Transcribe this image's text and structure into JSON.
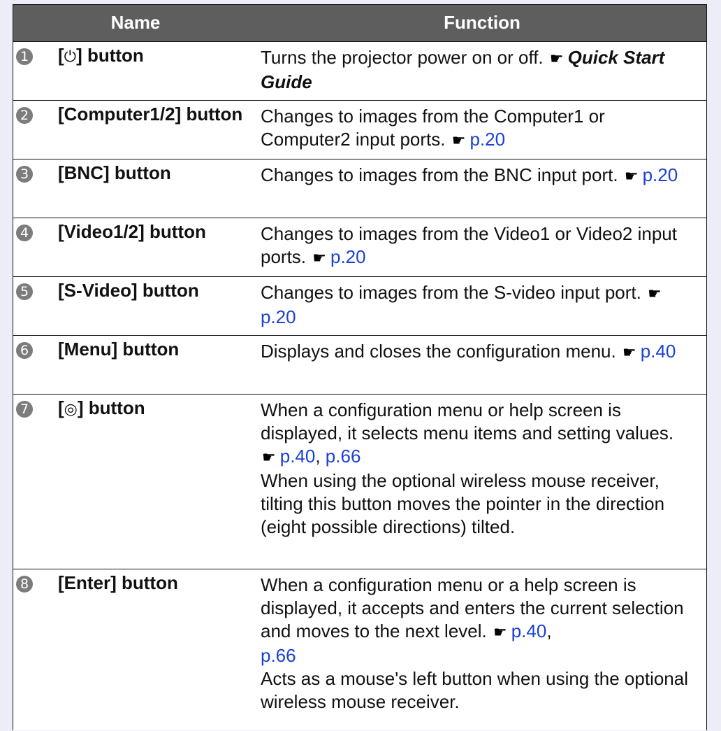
{
  "header": {
    "name": "Name",
    "function": "Function"
  },
  "rows": [
    {
      "number": "1",
      "name_pre": "[",
      "name_icon": "⏻",
      "name_icon_name": "power-icon",
      "name_post": "] button",
      "func_text": "Turns the projector power on or off.",
      "pointer_icon": "hand-pointing-right-icon",
      "func_ref": "Quick Start Guide"
    },
    {
      "number": "2",
      "name": "[Computer1/2] button",
      "func_text": "Changes to images from the Computer1 or Computer2 input ports.",
      "pointer_icon": "hand-pointing-right-icon",
      "func_link": "p.20"
    },
    {
      "number": "3",
      "name": "[BNC] button",
      "func_text": "Changes to images from the BNC input port.",
      "pointer_icon": "hand-pointing-right-icon",
      "func_link": "p.20"
    },
    {
      "number": "4",
      "name": "[Video1/2] button",
      "func_text": "Changes to images from the Video1 or Video2 input ports.",
      "pointer_icon": "hand-pointing-right-icon",
      "func_link": "p.20"
    },
    {
      "number": "5",
      "name": "[S-Video] button",
      "func_text": "Changes to images from the S-video input port.",
      "pointer_icon": "hand-pointing-right-icon",
      "func_link": "p.20"
    },
    {
      "number": "6",
      "name": "[Menu] button",
      "func_text": "Displays and closes the configuration menu.",
      "pointer_icon": "hand-pointing-right-icon",
      "func_link": "p.40"
    },
    {
      "number": "7",
      "name_pre": "[",
      "name_icon": "◎",
      "name_icon_name": "direction-pad-icon",
      "name_post": "] button",
      "func_text": "When a configuration menu or help screen is displayed, it selects menu items and setting values.",
      "pointer_icon": "hand-pointing-right-icon",
      "func_link": "p.40",
      "func_sep": ", ",
      "func_link2": "p.66",
      "func_text2": "When using the optional wireless mouse receiver, tilting this button moves the pointer in the direction (eight possible directions) tilted."
    },
    {
      "number": "8",
      "name": "[Enter] button",
      "func_text": "When a configuration menu or a help screen is displayed, it accepts and enters the current selection and moves to the next level.",
      "pointer_icon": "hand-pointing-right-icon",
      "func_link": "p.40",
      "func_sep": ",",
      "func_link2": "p.66",
      "func_text2": "Acts as a mouse's left button when using the optional wireless mouse receiver."
    }
  ],
  "colors": {
    "header_bg": "#5e5e5e",
    "page_bg": "#ecedf7",
    "link": "#1a40d8",
    "number_badge": "#7c7c7c"
  }
}
